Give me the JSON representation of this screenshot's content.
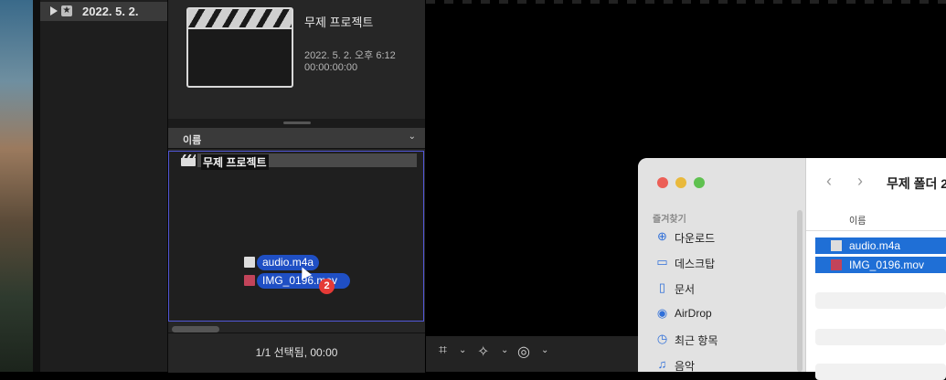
{
  "library": {
    "date": "2022. 5. 2."
  },
  "project": {
    "title": "무제 프로젝트",
    "date": "2022. 5. 2. 오후 6:12",
    "timecode": "00:00:00:00"
  },
  "browser": {
    "column_header": "이름",
    "project_row": "무제 프로젝트",
    "drag_items": [
      "audio.m4a",
      "IMG_0196.mov"
    ],
    "drag_count": "2",
    "status": "1/1 선택됨, 00:00"
  },
  "finder": {
    "title": "무제 폴더 2",
    "favorites_label": "즐겨찾기",
    "sidebar": [
      {
        "label": "다운로드",
        "icon": "download-icon"
      },
      {
        "label": "데스크탑",
        "icon": "desktop-icon"
      },
      {
        "label": "문서",
        "icon": "document-icon"
      },
      {
        "label": "AirDrop",
        "icon": "airdrop-icon"
      },
      {
        "label": "최근 항목",
        "icon": "clock-icon"
      },
      {
        "label": "음악",
        "icon": "music-icon"
      }
    ],
    "column_name": "이름",
    "files": [
      "audio.m4a",
      "IMG_0196.mov"
    ]
  },
  "colors": {
    "selection": "#1f4fc4",
    "list_border": "#5257d8",
    "badge": "#e53a36"
  }
}
